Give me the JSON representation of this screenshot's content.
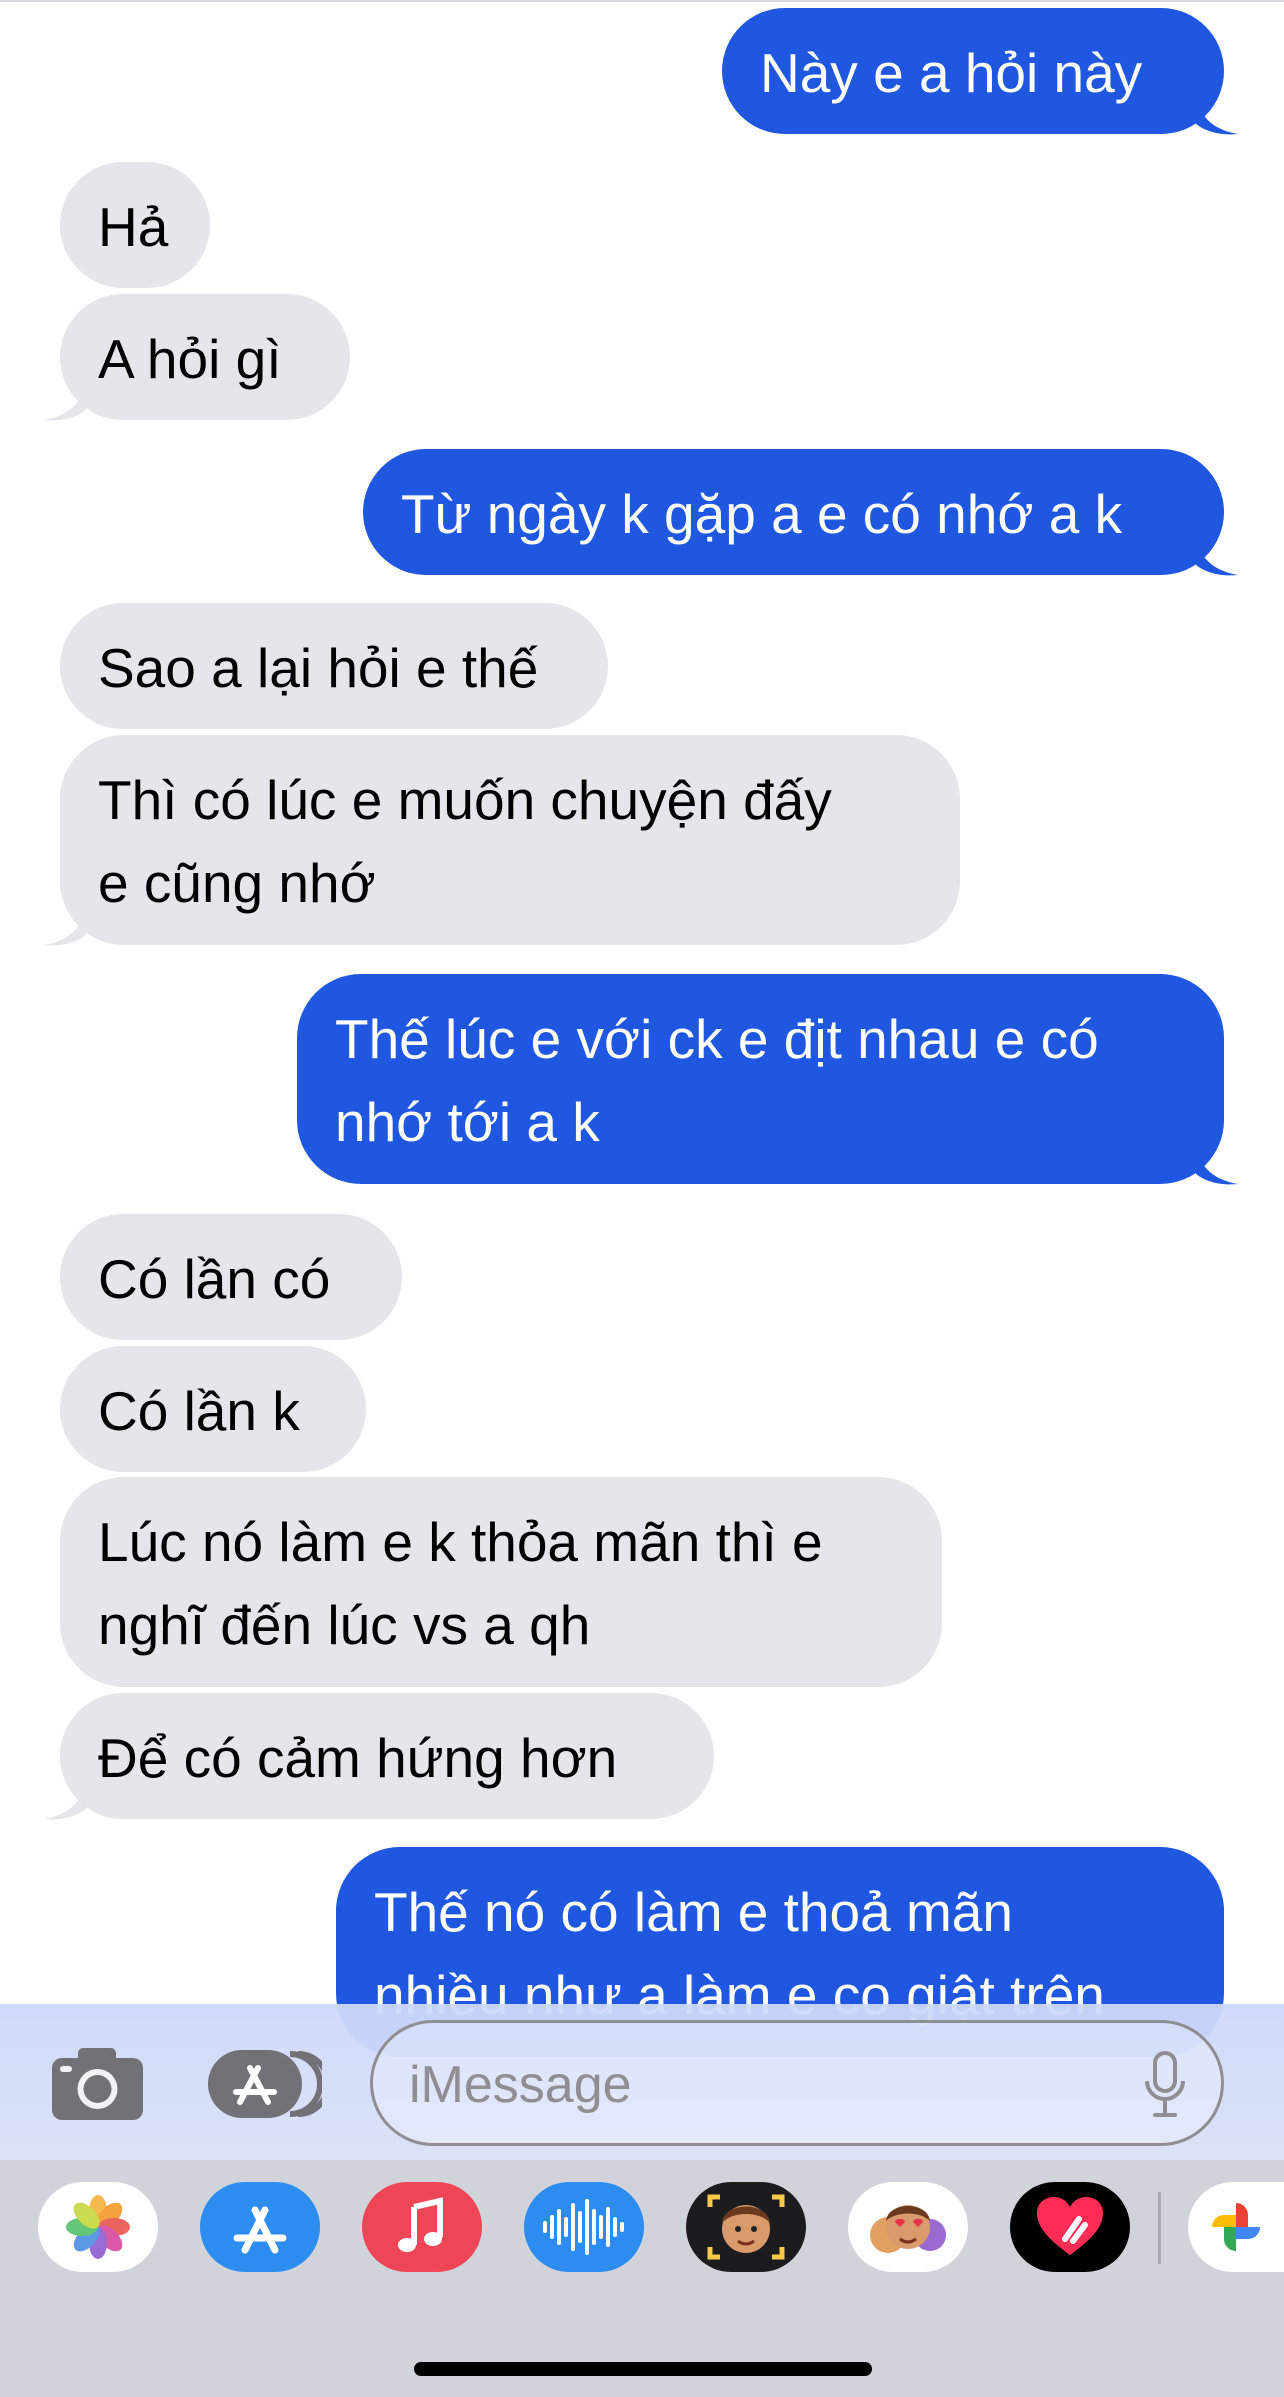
{
  "messages": [
    {
      "dir": "sent",
      "text": "Này e a hỏi này"
    },
    {
      "dir": "recv",
      "text": "Hả"
    },
    {
      "dir": "recv",
      "text": "A hỏi gì"
    },
    {
      "dir": "sent",
      "text": "Từ ngày k gặp a e có nhớ a k"
    },
    {
      "dir": "recv",
      "text": "Sao a lại hỏi e thế"
    },
    {
      "dir": "recv",
      "text": "Thì có lúc e muốn chuyện đấy\ne cũng nhớ"
    },
    {
      "dir": "sent",
      "text": "Thế lúc e với ck e địt nhau e có\nnhớ tới a k"
    },
    {
      "dir": "recv",
      "text": "Có lần có"
    },
    {
      "dir": "recv",
      "text": "Có lần k"
    },
    {
      "dir": "recv",
      "text": "Lúc nó làm e k thỏa mãn thì e\nnghĩ đến lúc vs a qh"
    },
    {
      "dir": "recv",
      "text": "Để có cảm hứng hơn"
    },
    {
      "dir": "sent",
      "text": "Thế nó có làm e thoả mãn\nnhiều như a làm e co giật trên"
    }
  ],
  "composer": {
    "placeholder": "iMessage",
    "camera_icon": "camera-icon",
    "apps_icon": "app-store-icon",
    "mic_icon": "microphone-icon"
  },
  "app_drawer": {
    "apps": [
      "photos-icon",
      "app-store-icon",
      "music-icon",
      "audio-message-icon",
      "memoji-icon",
      "memoji-stickers-icon",
      "digital-touch-icon",
      "google-photos-icon"
    ]
  },
  "colors": {
    "sent_bubble": "#1f57e0",
    "received_bubble": "#e5e5ea",
    "background": "#ffffff",
    "drawer": "#d1d3da"
  }
}
